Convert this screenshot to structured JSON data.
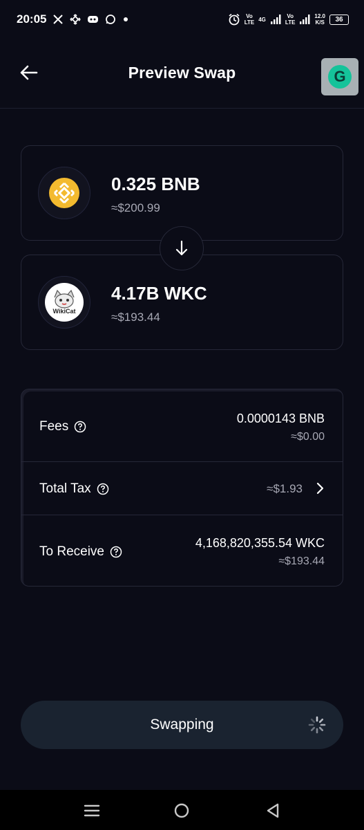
{
  "status_bar": {
    "time": "20:05",
    "net1_top": "Vo",
    "net1_bottom": "LTE",
    "net2_top": "4G",
    "net3_top": "Vo",
    "net3_bottom": "LTE",
    "speed_top": "12.0",
    "speed_bottom": "K/S",
    "battery": "36"
  },
  "header": {
    "title": "Preview Swap",
    "badge_letter": "G"
  },
  "from_token": {
    "amount": "0.325 BNB",
    "usd": "≈$200.99",
    "icon": "bnb-logo"
  },
  "to_token": {
    "amount": "4.17B WKC",
    "usd": "≈$193.44",
    "icon": "wkc-logo",
    "logo_text": "WikiCat"
  },
  "details": {
    "fees": {
      "label": "Fees",
      "value": "0.0000143 BNB",
      "sub": "≈$0.00"
    },
    "tax": {
      "label": "Total Tax",
      "value": "≈$1.93"
    },
    "receive": {
      "label": "To Receive",
      "value": "4,168,820,355.54 WKC",
      "sub": "≈$193.44"
    }
  },
  "action": {
    "label": "Swapping"
  },
  "colors": {
    "background": "#0b0c17",
    "bnb": "#f3ba2f",
    "button": "#1a2330",
    "muted_text": "#a7a8b4"
  }
}
